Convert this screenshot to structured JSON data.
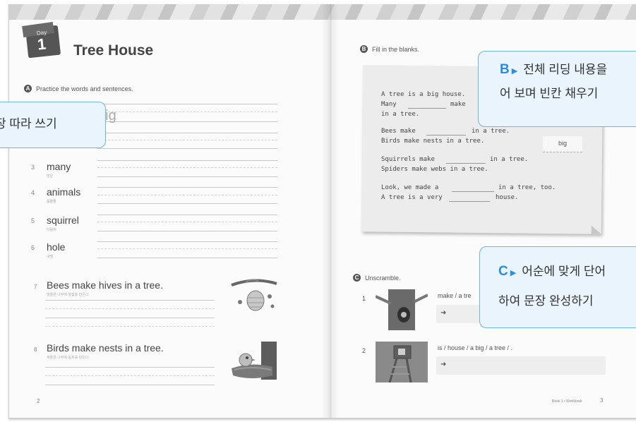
{
  "left_page": {
    "day_label": "Day",
    "day_number": "1",
    "title": "Tree House",
    "section_a": {
      "letter": "A",
      "instruction": "Practice the words and sentences.",
      "faint_word": "big",
      "words": [
        {
          "num": "3",
          "word": "many",
          "sub": "많은"
        },
        {
          "num": "4",
          "word": "animals",
          "sub": "동물들"
        },
        {
          "num": "5",
          "word": "squirrel",
          "sub": "다람쥐"
        },
        {
          "num": "6",
          "word": "hole",
          "sub": "구멍"
        }
      ],
      "sentences": [
        {
          "num": "7",
          "text": "Bees make hives in a tree.",
          "sub": "벌들은 나무에 벌집을 만든다."
        },
        {
          "num": "8",
          "text": "Birds make nests in a tree.",
          "sub": "새들은 나무에 둥지를 만든다."
        }
      ]
    },
    "page_number": "2"
  },
  "right_page": {
    "section_b": {
      "letter": "B",
      "instruction": "Fill in the blanks.",
      "lines": [
        "A tree is a big house.",
        "Many",
        "make",
        "in a tree.",
        "Bees make",
        "in a tree.",
        "Birds make nests in a tree.",
        "Squirrels make",
        "in a tree.",
        "Spiders make webs in a tree.",
        "Look, we made a",
        "in a tree, too.",
        "A tree is a very",
        "house."
      ],
      "word_box": "big"
    },
    "section_c": {
      "letter": "C",
      "instruction": "Unscramble.",
      "items": [
        {
          "num": "1",
          "prompt": "make / a tre",
          "arrow": "➜"
        },
        {
          "num": "2",
          "prompt": "is / house / a big / a tree / .",
          "arrow": "➜"
        }
      ]
    },
    "footer": "Book 1 • Workbook",
    "page_number": "3"
  },
  "callouts": {
    "left": {
      "text": "장 따라 쓰기"
    },
    "b": {
      "lead": "B",
      "marker": "▶",
      "line1": "전체 리딩 내용을",
      "line2": "어 보며 빈칸 채우기"
    },
    "c": {
      "lead": "C",
      "marker": "▶",
      "line1": "어순에 맞게 단어",
      "line2": "하여 문장 완성하기"
    }
  },
  "colors": {
    "callout_bg": "#e9f4fd",
    "callout_border": "#6fb6e8",
    "accent": "#2a8ee0"
  }
}
